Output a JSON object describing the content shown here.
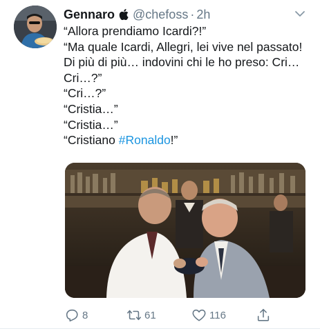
{
  "author": {
    "name": "Gennaro",
    "handle": "@chefoss",
    "separator": "·",
    "time": "2h"
  },
  "tweet": {
    "lines": [
      "“Allora prendiamo Icardi?!”",
      "“Ma quale Icardi, Allegri, lei vive nel passato! Di più di più… indovini chi le ho preso: Cri… Cri…?”",
      "“Cri…?”",
      "“Cristia…”",
      "“Cristia…”"
    ],
    "last_line_prefix": "“Cristiano ",
    "hashtag": "#Ronaldo",
    "last_line_suffix": "!”"
  },
  "actions": {
    "reply_count": "8",
    "retweet_count": "61",
    "like_count": "116"
  },
  "colors": {
    "text": "#14171a",
    "secondary": "#657786",
    "link": "#1b95e0"
  },
  "icons": {
    "verified_device": "apple-icon",
    "menu": "chevron-down-icon",
    "reply": "reply-icon",
    "retweet": "retweet-icon",
    "like": "heart-icon",
    "share": "share-icon"
  }
}
